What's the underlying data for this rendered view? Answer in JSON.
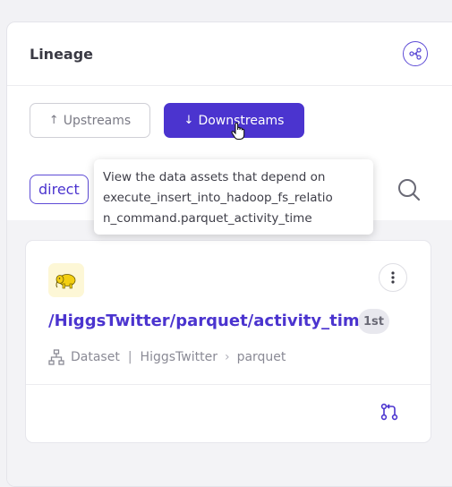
{
  "header": {
    "title": "Lineage",
    "share_icon": "share-graph-icon"
  },
  "tabs": {
    "upstreams_label": "Upstreams",
    "downstreams_label": "Downstreams",
    "active": "downstreams",
    "active_color": "#4b34cf"
  },
  "filter": {
    "chip_label": "direct",
    "search_icon": "search-icon"
  },
  "tooltip": {
    "lines": [
      "View the data assets that depend on",
      "execute_insert_into_hadoop_fs_relatio",
      "n_command.parquet_activity_time"
    ]
  },
  "card": {
    "logo_icon": "hadoop-elephant-icon",
    "name": "/HiggsTwitter/parquet/activity_time",
    "rank": "1st",
    "type": "Dataset",
    "path": [
      "HiggsTwitter",
      "parquet"
    ],
    "more_icon": "more-vertical-icon",
    "action_icon": "lineage-icon"
  }
}
